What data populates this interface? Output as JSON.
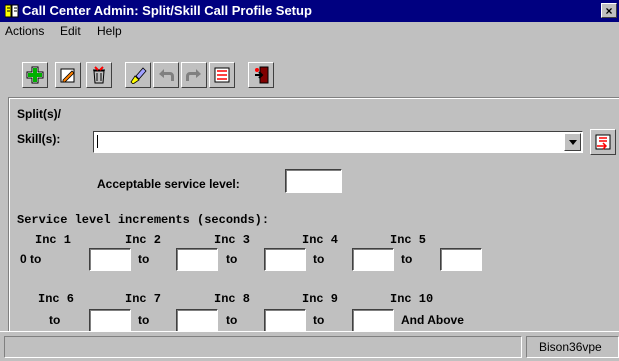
{
  "window": {
    "title": "Call Center Admin: Split/Skill Call Profile Setup",
    "close_glyph": "×"
  },
  "menu": [
    "Actions",
    "Edit",
    "Help"
  ],
  "toolbar": {
    "icons": [
      "add-icon",
      "edit-icon",
      "delete-icon",
      "clear-icon",
      "undo-icon",
      "redo-icon",
      "list-icon",
      "exit-icon"
    ]
  },
  "form": {
    "split_label_1": "Split(s)/",
    "split_label_2": "Skill(s):",
    "split_value": "",
    "acceptable_label": "Acceptable service level:",
    "acceptable_value": "",
    "increments_heading": "Service level increments (seconds):",
    "row1_headers": [
      "Inc 1",
      "Inc 2",
      "Inc 3",
      "Inc 4",
      "Inc 5"
    ],
    "row1_prefix": "0 to",
    "row1_to": [
      "to",
      "to",
      "to",
      "to"
    ],
    "row2_headers": [
      "Inc 6",
      "Inc 7",
      "Inc 8",
      "Inc 9",
      "Inc 10"
    ],
    "row2_to": [
      "to",
      "to",
      "to",
      "to"
    ],
    "row2_suffix": "And Above",
    "inc_values": [
      "",
      "",
      "",
      "",
      "",
      "",
      "",
      "",
      ""
    ]
  },
  "status": {
    "message": "",
    "user": "Bison36vpe"
  },
  "colors": {
    "title_bg": "#000080",
    "window_bg": "#c0c0c0"
  }
}
